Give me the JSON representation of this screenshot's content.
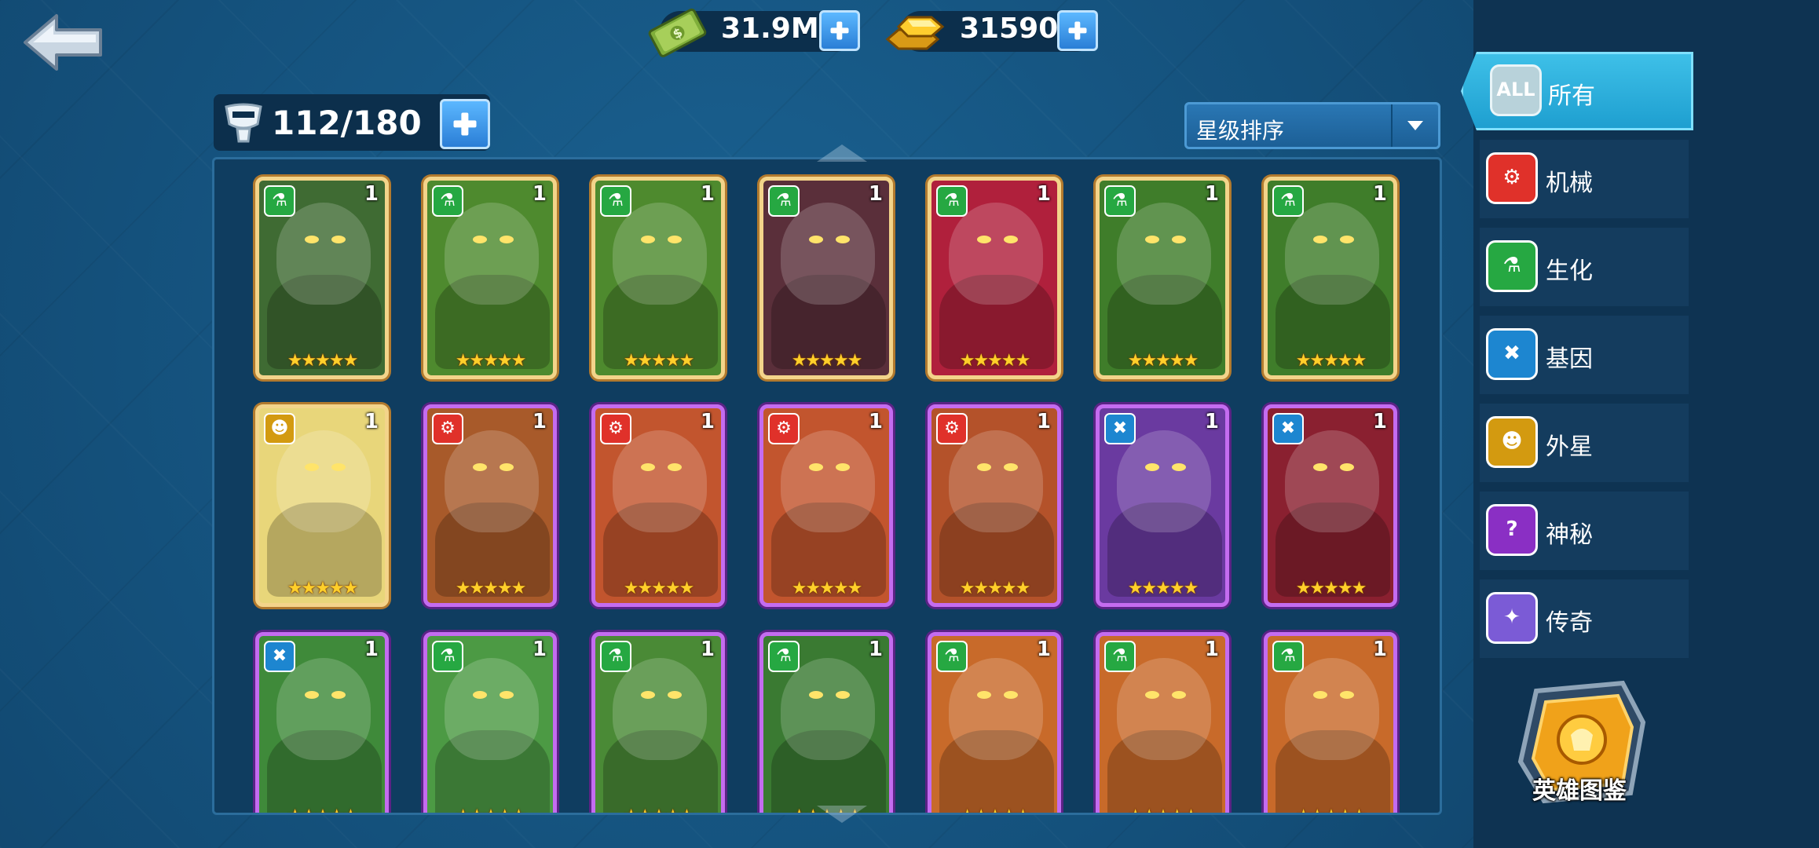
{
  "currency": {
    "cash": "31.9M",
    "gold": "31590"
  },
  "roster": {
    "capacity": "112/180"
  },
  "sort": {
    "label": "星级排序"
  },
  "filters": [
    {
      "key": "all",
      "icon_text": "ALL",
      "label": "所有",
      "color": "#2fb3e0",
      "icon": "all-icon"
    },
    {
      "key": "mech",
      "label": "机械",
      "color": "#e0312a",
      "icon": "mechanical-icon"
    },
    {
      "key": "bio",
      "label": "生化",
      "color": "#26a842",
      "icon": "biochem-flask-icon"
    },
    {
      "key": "gene",
      "label": "基因",
      "color": "#1d86d0",
      "icon": "dna-icon"
    },
    {
      "key": "alien",
      "label": "外星",
      "color": "#d39a10",
      "icon": "alien-icon"
    },
    {
      "key": "mystic",
      "label": "神秘",
      "color": "#8a2fc4",
      "icon": "mystery-icon"
    },
    {
      "key": "legend",
      "label": "传奇",
      "color": "#7b5bd6",
      "icon": "legend-icon"
    }
  ],
  "codex": {
    "label": "英雄图鉴"
  },
  "cards": [
    {
      "type": "bio",
      "rarity": "gold",
      "level": "1",
      "stars": "★★★★★",
      "art": "#3f6b33"
    },
    {
      "type": "bio",
      "rarity": "gold",
      "level": "1",
      "stars": "★★★★★",
      "art": "#4e8a2e"
    },
    {
      "type": "bio",
      "rarity": "gold",
      "level": "1",
      "stars": "★★★★★",
      "art": "#4e8a2e"
    },
    {
      "type": "bio",
      "rarity": "gold",
      "level": "1",
      "stars": "★★★★★",
      "art": "#5a2f3a"
    },
    {
      "type": "bio",
      "rarity": "gold",
      "level": "1",
      "stars": "★★★★★",
      "art": "#b0203c"
    },
    {
      "type": "bio",
      "rarity": "gold",
      "level": "1",
      "stars": "★★★★★",
      "art": "#3f7d2a"
    },
    {
      "type": "bio",
      "rarity": "gold",
      "level": "1",
      "stars": "★★★★★",
      "art": "#3f7d2a"
    },
    {
      "type": "alien",
      "rarity": "gold",
      "level": "1",
      "stars": "★★★★★",
      "art": "#e8d67a"
    },
    {
      "type": "mech",
      "rarity": "purple",
      "level": "1",
      "stars": "★★★★★",
      "art": "#a85a2a"
    },
    {
      "type": "mech",
      "rarity": "purple",
      "level": "1",
      "stars": "★★★★★",
      "art": "#c2552e"
    },
    {
      "type": "mech",
      "rarity": "purple",
      "level": "1",
      "stars": "★★★★★",
      "art": "#c2552e"
    },
    {
      "type": "mech",
      "rarity": "purple",
      "level": "1",
      "stars": "★★★★★",
      "art": "#b4522a"
    },
    {
      "type": "gene",
      "rarity": "purple",
      "level": "1",
      "stars": "★★★★★",
      "art": "#6a3aa0"
    },
    {
      "type": "gene",
      "rarity": "purple",
      "level": "1",
      "stars": "★★★★★",
      "art": "#8a2030"
    },
    {
      "type": "gene",
      "rarity": "purple",
      "level": "1",
      "stars": "★★★★★",
      "art": "#3f8a3a"
    },
    {
      "type": "bio",
      "rarity": "purple",
      "level": "1",
      "stars": "★★★★★",
      "art": "#4c9a44"
    },
    {
      "type": "bio",
      "rarity": "purple",
      "level": "1",
      "stars": "★★★★★",
      "art": "#4a8a36"
    },
    {
      "type": "bio",
      "rarity": "purple",
      "level": "1",
      "stars": "★★★★★",
      "art": "#3a7a32"
    },
    {
      "type": "bio",
      "rarity": "purple",
      "level": "1",
      "stars": "★★★★★",
      "art": "#c86a2a"
    },
    {
      "type": "bio",
      "rarity": "purple",
      "level": "1",
      "stars": "★★★★★",
      "art": "#c86a2a"
    },
    {
      "type": "bio",
      "rarity": "purple",
      "level": "1",
      "stars": "★★★★★",
      "art": "#c86a2a"
    }
  ]
}
